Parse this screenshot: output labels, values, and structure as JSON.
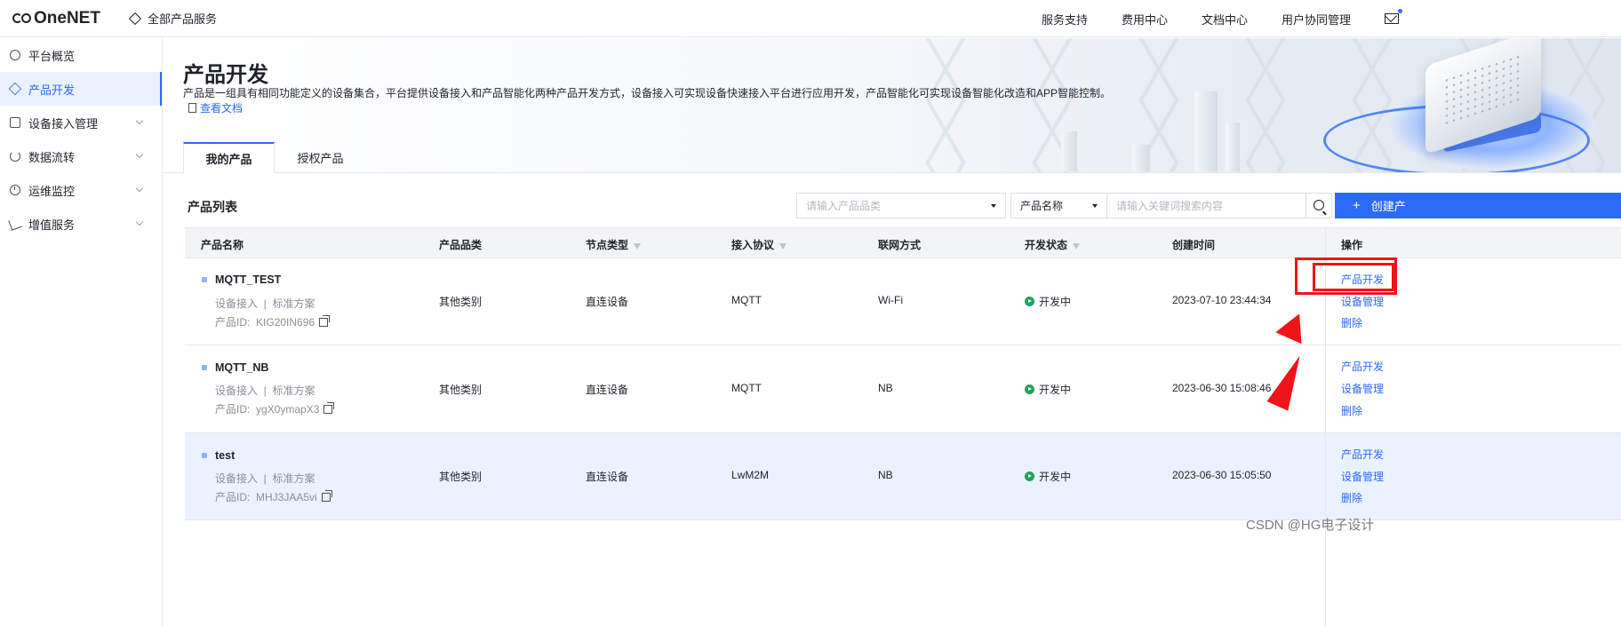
{
  "header": {
    "logo": "OneNET",
    "all_services": "全部产品服务",
    "nav": [
      "服务支持",
      "费用中心",
      "文档中心",
      "用户协同管理"
    ]
  },
  "sidebar": {
    "items": [
      {
        "label": "平台概览",
        "icon": "overview-icon"
      },
      {
        "label": "产品开发",
        "icon": "product-icon",
        "active": true
      },
      {
        "label": "设备接入管理",
        "icon": "device-icon"
      },
      {
        "label": "数据流转",
        "icon": "data-icon"
      },
      {
        "label": "运维监控",
        "icon": "monitor-icon"
      },
      {
        "label": "增值服务",
        "icon": "value-icon"
      }
    ]
  },
  "page": {
    "title": "产品开发",
    "description": "产品是一组具有相同功能定义的设备集合，平台提供设备接入和产品智能化两种产品开发方式，设备接入可实现设备快速接入平台进行应用开发，产品智能化可实现设备智能化改造和APP智能控制。",
    "doc_link": "查看文档",
    "tabs": [
      "我的产品",
      "授权产品"
    ]
  },
  "toolbar": {
    "list_title": "产品列表",
    "category_placeholder": "请输入产品品类",
    "field_select": "产品名称",
    "search_placeholder": "请输入关键词搜索内容",
    "create_label": "创建产"
  },
  "table": {
    "columns": [
      "产品名称",
      "产品品类",
      "节点类型",
      "接入协议",
      "联网方式",
      "开发状态",
      "创建时间",
      "操作"
    ],
    "rows": [
      {
        "name": "MQTT_TEST",
        "access": "设备接入",
        "scheme": "标准方案",
        "id_label": "产品ID:",
        "id": "KIG20IN696",
        "category": "其他类别",
        "node": "直连设备",
        "protocol": "MQTT",
        "network": "Wi-Fi",
        "status": "开发中",
        "created": "2023-07-10 23:44:34",
        "ops": [
          "产品开发",
          "设备管理",
          "删除"
        ]
      },
      {
        "name": "MQTT_NB",
        "access": "设备接入",
        "scheme": "标准方案",
        "id_label": "产品ID:",
        "id": "ygX0ymapX3",
        "category": "其他类别",
        "node": "直连设备",
        "protocol": "MQTT",
        "network": "NB",
        "status": "开发中",
        "created": "2023-06-30 15:08:46",
        "ops": [
          "产品开发",
          "设备管理",
          "删除"
        ]
      },
      {
        "name": "test",
        "access": "设备接入",
        "scheme": "标准方案",
        "id_label": "产品ID:",
        "id": "MHJ3JAA5vi",
        "category": "其他类别",
        "node": "直连设备",
        "protocol": "LwM2M",
        "network": "NB",
        "status": "开发中",
        "created": "2023-06-30 15:05:50",
        "ops": [
          "产品开发",
          "设备管理",
          "删除"
        ]
      }
    ]
  },
  "colors": {
    "accent": "#2e6bf5",
    "status_green": "#1fa35b",
    "annotation_red": "#f0141a"
  },
  "watermark": "CSDN @HG电子设计"
}
